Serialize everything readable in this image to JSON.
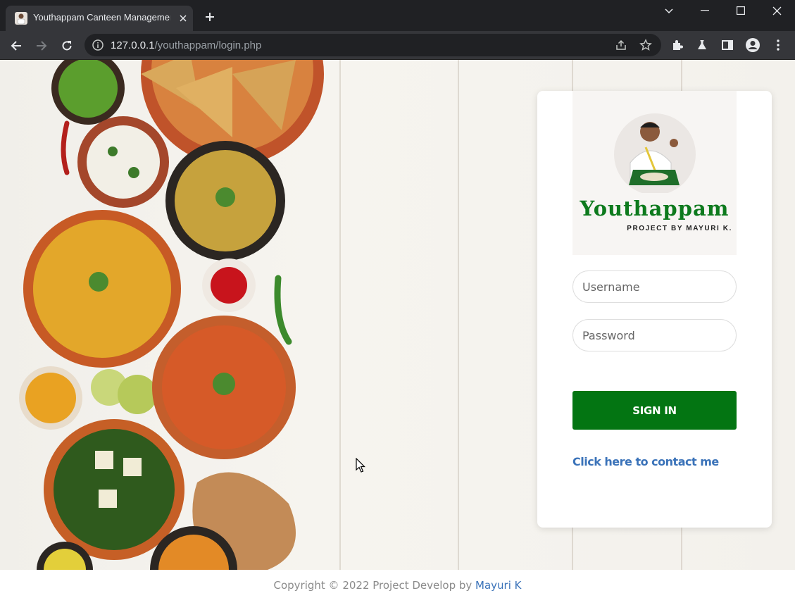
{
  "browser": {
    "tab_title": "Youthappam Canteen Management",
    "url_host": "127.0.0.1",
    "url_path": "/youthappam/login.php"
  },
  "login": {
    "brand": "Youthappam",
    "tagline": "PROJECT BY MAYURI K.",
    "username_placeholder": "Username",
    "password_placeholder": "Password",
    "signin_label": "SIGN IN",
    "contact_link": "Click here to contact me"
  },
  "footer": {
    "copyright": "Copyright © 2022 Project Develop by ",
    "author_link": "Mayuri K"
  },
  "colors": {
    "brand_green": "#037512",
    "link_blue": "#3b73b9"
  }
}
